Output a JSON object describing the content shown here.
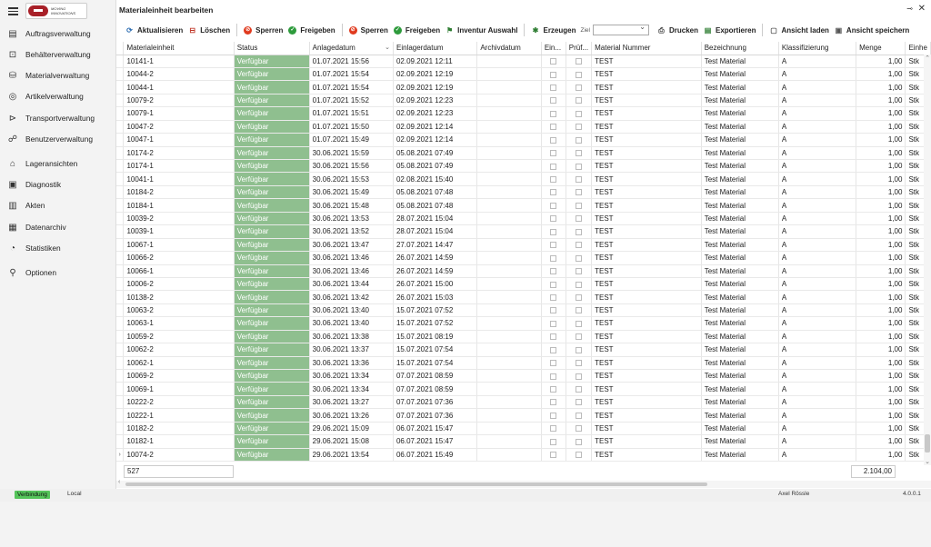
{
  "window": {
    "title": "Materialeinheit bearbeiten",
    "pin_icon": "pin-icon",
    "close_icon": "close-icon"
  },
  "sidebar": {
    "items": [
      {
        "label": "Auftragsverwaltung",
        "icon": "clipboard-icon",
        "glyph": "▤"
      },
      {
        "label": "Behälterverwaltung",
        "icon": "container-icon",
        "glyph": "⊡"
      },
      {
        "label": "Materialverwaltung",
        "icon": "material-icon",
        "glyph": "⛁"
      },
      {
        "label": "Artikelverwaltung",
        "icon": "article-icon",
        "glyph": "◎"
      },
      {
        "label": "Transportverwaltung",
        "icon": "transport-icon",
        "glyph": "⊳"
      },
      {
        "label": "Benutzerverwaltung",
        "icon": "users-icon",
        "glyph": "☍"
      },
      {
        "label": "Lageransichten",
        "icon": "warehouse-icon",
        "glyph": "⌂"
      },
      {
        "label": "Diagnostik",
        "icon": "diagnostics-icon",
        "glyph": "▣"
      },
      {
        "label": "Akten",
        "icon": "files-icon",
        "glyph": "▥"
      },
      {
        "label": "Datenarchiv",
        "icon": "archive-icon",
        "glyph": "▦"
      },
      {
        "label": "Statistiken",
        "icon": "statistics-icon",
        "glyph": "◔"
      },
      {
        "label": "Optionen",
        "icon": "options-icon",
        "glyph": "⚲"
      }
    ]
  },
  "toolbar": {
    "aktualisieren": "Aktualisieren",
    "loeschen": "Löschen",
    "sperren1": "Sperren",
    "freigeben1": "Freigeben",
    "sperren2": "Sperren",
    "freigeben2": "Freigeben",
    "inventur": "Inventur Auswahl",
    "erzeugen": "Erzeugen",
    "ziel_label": "Ziel",
    "ziel_value": "",
    "drucken": "Drucken",
    "exportieren": "Exportieren",
    "ansicht_laden": "Ansicht laden",
    "ansicht_speichern": "Ansicht speichern"
  },
  "table": {
    "columns": [
      "Materialeinheit",
      "Status",
      "Anlagedatum",
      "Einlagerdatum",
      "Archivdatum",
      "Ein...",
      "Prüf...",
      "Material Nummer",
      "Bezeichnung",
      "Klassifizierung",
      "Menge",
      "Einhe"
    ],
    "rows": [
      [
        "10141-1",
        "Verfügbar",
        "01.07.2021 15:56",
        "02.09.2021 12:11",
        "",
        "",
        "",
        "TEST",
        "Test Material",
        "A",
        "1,00",
        "Stk"
      ],
      [
        "10044-2",
        "Verfügbar",
        "01.07.2021 15:54",
        "02.09.2021 12:19",
        "",
        "",
        "",
        "TEST",
        "Test Material",
        "A",
        "1,00",
        "Stk"
      ],
      [
        "10044-1",
        "Verfügbar",
        "01.07.2021 15:54",
        "02.09.2021 12:19",
        "",
        "",
        "",
        "TEST",
        "Test Material",
        "A",
        "1,00",
        "Stk"
      ],
      [
        "10079-2",
        "Verfügbar",
        "01.07.2021 15:52",
        "02.09.2021 12:23",
        "",
        "",
        "",
        "TEST",
        "Test Material",
        "A",
        "1,00",
        "Stk"
      ],
      [
        "10079-1",
        "Verfügbar",
        "01.07.2021 15:51",
        "02.09.2021 12:23",
        "",
        "",
        "",
        "TEST",
        "Test Material",
        "A",
        "1,00",
        "Stk"
      ],
      [
        "10047-2",
        "Verfügbar",
        "01.07.2021 15:50",
        "02.09.2021 12:14",
        "",
        "",
        "",
        "TEST",
        "Test Material",
        "A",
        "1,00",
        "Stk"
      ],
      [
        "10047-1",
        "Verfügbar",
        "01.07.2021 15:49",
        "02.09.2021 12:14",
        "",
        "",
        "",
        "TEST",
        "Test Material",
        "A",
        "1,00",
        "Stk"
      ],
      [
        "10174-2",
        "Verfügbar",
        "30.06.2021 15:59",
        "05.08.2021 07:49",
        "",
        "",
        "",
        "TEST",
        "Test Material",
        "A",
        "1,00",
        "Stk"
      ],
      [
        "10174-1",
        "Verfügbar",
        "30.06.2021 15:56",
        "05.08.2021 07:49",
        "",
        "",
        "",
        "TEST",
        "Test Material",
        "A",
        "1,00",
        "Stk"
      ],
      [
        "10041-1",
        "Verfügbar",
        "30.06.2021 15:53",
        "02.08.2021 15:40",
        "",
        "",
        "",
        "TEST",
        "Test Material",
        "A",
        "1,00",
        "Stk"
      ],
      [
        "10184-2",
        "Verfügbar",
        "30.06.2021 15:49",
        "05.08.2021 07:48",
        "",
        "",
        "",
        "TEST",
        "Test Material",
        "A",
        "1,00",
        "Stk"
      ],
      [
        "10184-1",
        "Verfügbar",
        "30.06.2021 15:48",
        "05.08.2021 07:48",
        "",
        "",
        "",
        "TEST",
        "Test Material",
        "A",
        "1,00",
        "Stk"
      ],
      [
        "10039-2",
        "Verfügbar",
        "30.06.2021 13:53",
        "28.07.2021 15:04",
        "",
        "",
        "",
        "TEST",
        "Test Material",
        "A",
        "1,00",
        "Stk"
      ],
      [
        "10039-1",
        "Verfügbar",
        "30.06.2021 13:52",
        "28.07.2021 15:04",
        "",
        "",
        "",
        "TEST",
        "Test Material",
        "A",
        "1,00",
        "Stk"
      ],
      [
        "10067-1",
        "Verfügbar",
        "30.06.2021 13:47",
        "27.07.2021 14:47",
        "",
        "",
        "",
        "TEST",
        "Test Material",
        "A",
        "1,00",
        "Stk"
      ],
      [
        "10066-2",
        "Verfügbar",
        "30.06.2021 13:46",
        "26.07.2021 14:59",
        "",
        "",
        "",
        "TEST",
        "Test Material",
        "A",
        "1,00",
        "Stk"
      ],
      [
        "10066-1",
        "Verfügbar",
        "30.06.2021 13:46",
        "26.07.2021 14:59",
        "",
        "",
        "",
        "TEST",
        "Test Material",
        "A",
        "1,00",
        "Stk"
      ],
      [
        "10006-2",
        "Verfügbar",
        "30.06.2021 13:44",
        "26.07.2021 15:00",
        "",
        "",
        "",
        "TEST",
        "Test Material",
        "A",
        "1,00",
        "Stk"
      ],
      [
        "10138-2",
        "Verfügbar",
        "30.06.2021 13:42",
        "26.07.2021 15:03",
        "",
        "",
        "",
        "TEST",
        "Test Material",
        "A",
        "1,00",
        "Stk"
      ],
      [
        "10063-2",
        "Verfügbar",
        "30.06.2021 13:40",
        "15.07.2021 07:52",
        "",
        "",
        "",
        "TEST",
        "Test Material",
        "A",
        "1,00",
        "Stk"
      ],
      [
        "10063-1",
        "Verfügbar",
        "30.06.2021 13:40",
        "15.07.2021 07:52",
        "",
        "",
        "",
        "TEST",
        "Test Material",
        "A",
        "1,00",
        "Stk"
      ],
      [
        "10059-2",
        "Verfügbar",
        "30.06.2021 13:38",
        "15.07.2021 08:19",
        "",
        "",
        "",
        "TEST",
        "Test Material",
        "A",
        "1,00",
        "Stk"
      ],
      [
        "10062-2",
        "Verfügbar",
        "30.06.2021 13:37",
        "15.07.2021 07:54",
        "",
        "",
        "",
        "TEST",
        "Test Material",
        "A",
        "1,00",
        "Stk"
      ],
      [
        "10062-1",
        "Verfügbar",
        "30.06.2021 13:36",
        "15.07.2021 07:54",
        "",
        "",
        "",
        "TEST",
        "Test Material",
        "A",
        "1,00",
        "Stk"
      ],
      [
        "10069-2",
        "Verfügbar",
        "30.06.2021 13:34",
        "07.07.2021 08:59",
        "",
        "",
        "",
        "TEST",
        "Test Material",
        "A",
        "1,00",
        "Stk"
      ],
      [
        "10069-1",
        "Verfügbar",
        "30.06.2021 13:34",
        "07.07.2021 08:59",
        "",
        "",
        "",
        "TEST",
        "Test Material",
        "A",
        "1,00",
        "Stk"
      ],
      [
        "10222-2",
        "Verfügbar",
        "30.06.2021 13:27",
        "07.07.2021 07:36",
        "",
        "",
        "",
        "TEST",
        "Test Material",
        "A",
        "1,00",
        "Stk"
      ],
      [
        "10222-1",
        "Verfügbar",
        "30.06.2021 13:26",
        "07.07.2021 07:36",
        "",
        "",
        "",
        "TEST",
        "Test Material",
        "A",
        "1,00",
        "Stk"
      ],
      [
        "10182-2",
        "Verfügbar",
        "29.06.2021 15:09",
        "06.07.2021 15:47",
        "",
        "",
        "",
        "TEST",
        "Test Material",
        "A",
        "1,00",
        "Stk"
      ],
      [
        "10182-1",
        "Verfügbar",
        "29.06.2021 15:08",
        "06.07.2021 15:47",
        "",
        "",
        "",
        "TEST",
        "Test Material",
        "A",
        "1,00",
        "Stk"
      ],
      [
        "10074-2",
        "Verfügbar",
        "29.06.2021 13:54",
        "06.07.2021 15:49",
        "",
        "",
        "",
        "TEST",
        "Test Material",
        "A",
        "1,00",
        "Stk"
      ]
    ],
    "footer_count": "527",
    "footer_sum": "2.104,00",
    "status_color": "#8fbf8f"
  },
  "statusbar": {
    "connection": "Verbindung",
    "connection_color": "#55c45a",
    "location": "Local",
    "user": "Axel Rössle",
    "version": "4.0.0.1"
  }
}
